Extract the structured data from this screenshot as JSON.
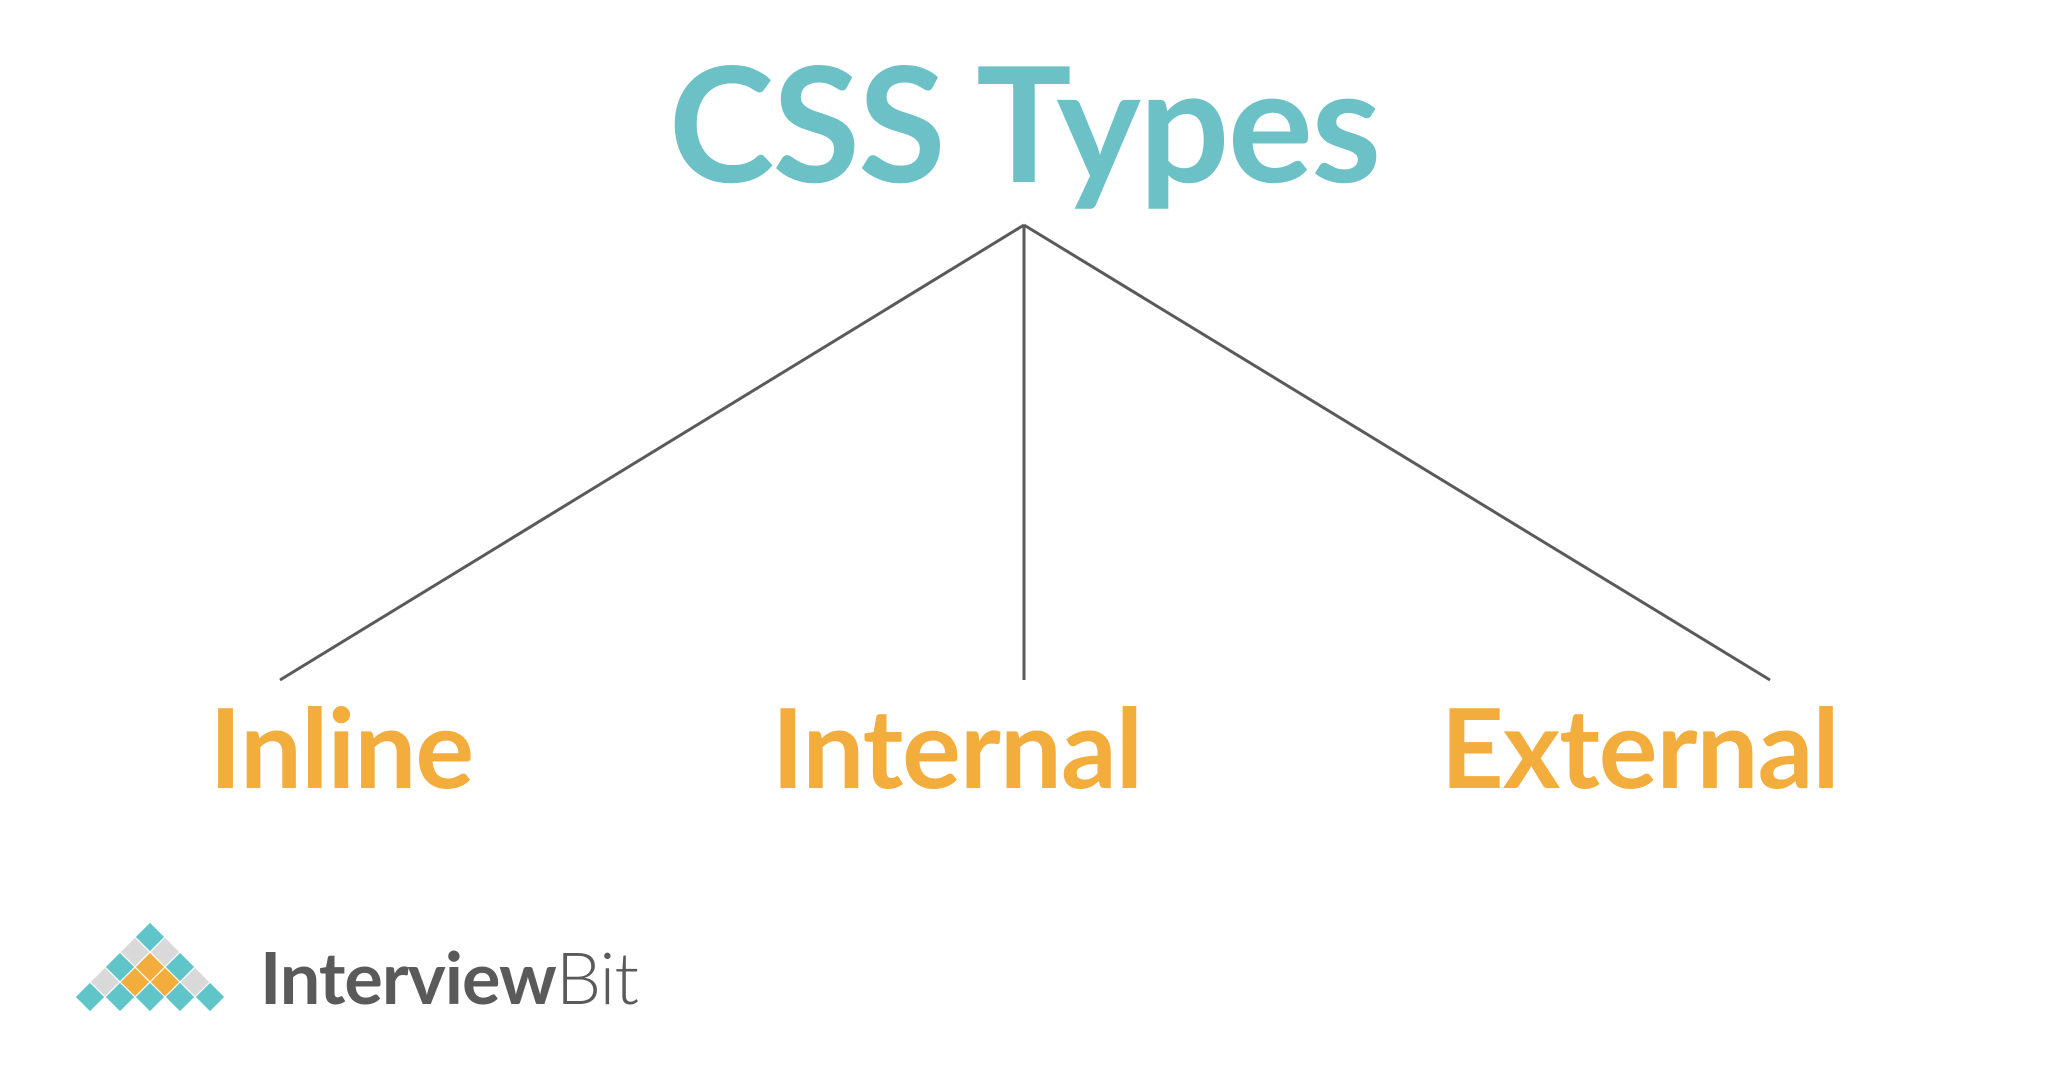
{
  "diagram": {
    "root": "CSS Types",
    "children": [
      "Inline",
      "Internal",
      "External"
    ]
  },
  "brand": {
    "name_bold": "Interview",
    "name_light": "Bit"
  },
  "colors": {
    "title": "#6cc1c7",
    "children": "#f3ad3d",
    "line": "#5a5a5a",
    "brand_text": "#5a5a5a",
    "brand_teal": "#5fc5c9",
    "brand_orange": "#f3ad3d",
    "brand_gray": "#d9d9d9"
  }
}
